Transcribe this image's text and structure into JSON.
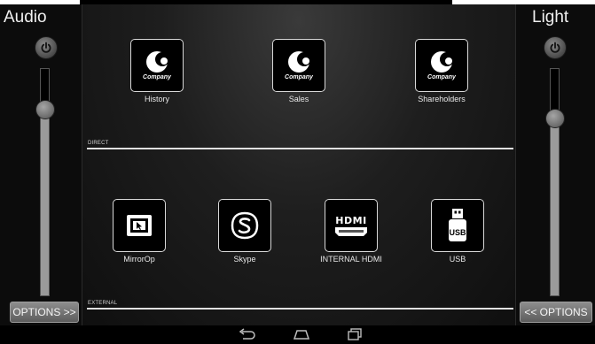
{
  "audio_panel": {
    "title": "Audio",
    "volume_level": 0.82,
    "options_label": "OPTIONS >>"
  },
  "light_panel": {
    "title": "Light",
    "level": 0.78,
    "options_label": "<< OPTIONS"
  },
  "direct_section": {
    "label": "DIRECT",
    "tiles": [
      {
        "label": "History",
        "logo_text": "Company",
        "icon": "company-logo-icon"
      },
      {
        "label": "Sales",
        "logo_text": "Company",
        "icon": "company-logo-icon"
      },
      {
        "label": "Shareholders",
        "logo_text": "Company",
        "icon": "company-logo-icon"
      }
    ]
  },
  "external_section": {
    "label": "EXTERNAL",
    "tiles": [
      {
        "label": "MirrorOp",
        "icon": "mirrorop-icon"
      },
      {
        "label": "Skype",
        "icon": "skype-icon"
      },
      {
        "label": "INTERNAL HDMI",
        "icon": "hdmi-icon",
        "icon_text": "HDMI"
      },
      {
        "label": "USB",
        "icon": "usb-icon",
        "icon_text": "USB"
      }
    ]
  },
  "colors": {
    "background": "#050505",
    "tile_border": "#d8d8d8",
    "slider_fill": "#9a9a9a"
  },
  "navbar": {
    "icons": [
      "back-icon",
      "home-icon",
      "recent-apps-icon"
    ]
  }
}
